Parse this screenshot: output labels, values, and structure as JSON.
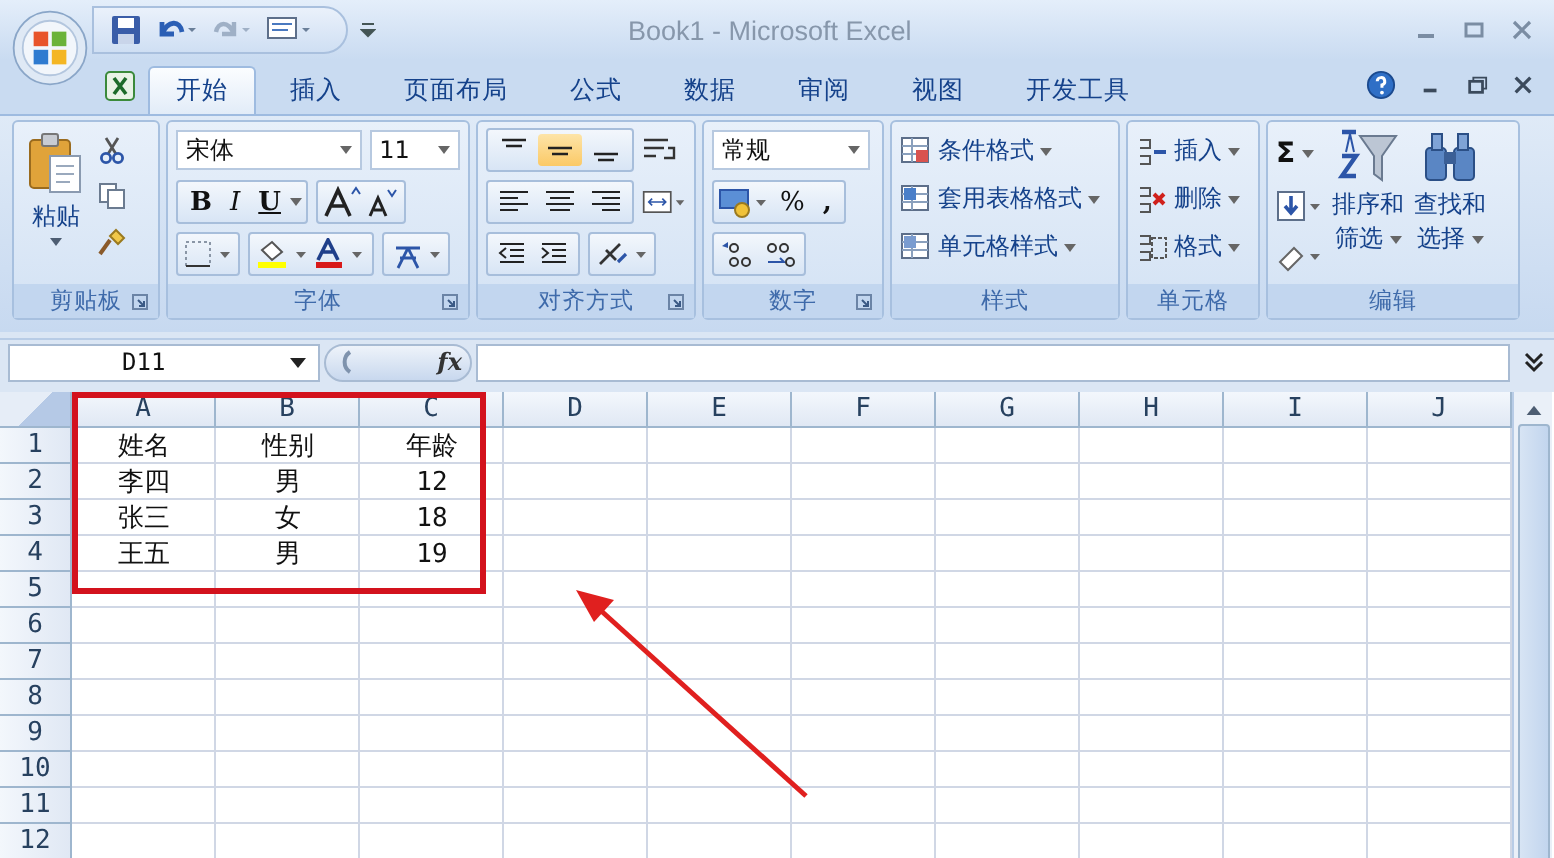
{
  "window": {
    "title": "Book1 - Microsoft Excel"
  },
  "tabs": [
    {
      "label": "开始",
      "selected": true
    },
    {
      "label": "插入",
      "selected": false
    },
    {
      "label": "页面布局",
      "selected": false
    },
    {
      "label": "公式",
      "selected": false
    },
    {
      "label": "数据",
      "selected": false
    },
    {
      "label": "审阅",
      "selected": false
    },
    {
      "label": "视图",
      "selected": false
    },
    {
      "label": "开发工具",
      "selected": false
    }
  ],
  "ribbon": {
    "clipboard": {
      "label": "剪贴板",
      "paste": "粘贴"
    },
    "font": {
      "label": "字体",
      "font_name": "宋体",
      "font_size": "11",
      "bold": "B",
      "italic": "I",
      "underline": "U"
    },
    "alignment": {
      "label": "对齐方式",
      "vertical": [
        {
          "selected": false
        },
        {
          "selected": true
        },
        {
          "selected": false
        }
      ]
    },
    "number": {
      "label": "数字",
      "format": "常规",
      "percent": "%",
      "comma": ","
    },
    "styles": {
      "label": "样式",
      "buttons": [
        "条件格式",
        "套用表格格式",
        "单元格样式"
      ]
    },
    "cells": {
      "label": "单元格",
      "buttons": [
        "插入",
        "删除",
        "格式"
      ]
    },
    "editing": {
      "label": "编辑",
      "sum": "Σ",
      "sort": [
        "排序和",
        "筛选"
      ],
      "find": [
        "查找和",
        "选择"
      ]
    }
  },
  "formula_bar": {
    "name_box": "D11",
    "function_label": "fx"
  },
  "sheet": {
    "columns": [
      "A",
      "B",
      "C",
      "D",
      "E",
      "F",
      "G",
      "H",
      "I",
      "J"
    ],
    "rows": [
      {
        "number": "1",
        "cells": [
          "姓名",
          "性别",
          "年龄"
        ]
      },
      {
        "number": "2",
        "cells": [
          "李四",
          "男",
          "12"
        ]
      },
      {
        "number": "3",
        "cells": [
          "张三",
          "女",
          "18"
        ]
      },
      {
        "number": "4",
        "cells": [
          "王五",
          "男",
          "19"
        ]
      },
      {
        "number": "5"
      },
      {
        "number": "6"
      },
      {
        "number": "7"
      },
      {
        "number": "8"
      },
      {
        "number": "9"
      },
      {
        "number": "10"
      },
      {
        "number": "11"
      },
      {
        "number": "12"
      }
    ]
  }
}
